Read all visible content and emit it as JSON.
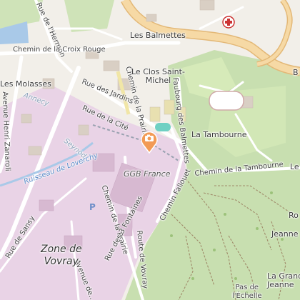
{
  "map": {
    "colors": {
      "urban": "#f2efe9",
      "commercial": "#e9d3e6",
      "forest": "#c8dfb0",
      "park": "#d6eab9",
      "major_road": "#f6d9a5",
      "water": "#a9c9e8",
      "marker": "#f29a55"
    },
    "labels": {
      "rue_vernon": "Rue de l'Hermon",
      "les_balmettes": "Les Balmettes",
      "croix_rouge": "Chemin de la Croix Rouge",
      "les_molasses": "Les Molasses",
      "annecy": "Annecy",
      "henri_zanaroli": "Avenue Henri Zanaroli",
      "rue_des_jardins": "Rue des Jardins",
      "chemin_prairie_top": "Chemin de la Prairie",
      "le_clos": "Le Clos Saint-\nMichel",
      "faubourg": "Faubourg des Balmettes",
      "la_tambourne": "La Tambourne",
      "rue_cite": "Rue de la Cité",
      "seynod": "Seynod",
      "ruisseau": "Ruisseau de Loverchy",
      "ggb": "GGB France",
      "chemin_tambourne": "Chemin de la Tambourne",
      "chemin_fallouet": "Chemin Fallouet",
      "chemin_prairie_bottom": "Chemin de la Prairie",
      "trois_fontaines": "Rue des 3 Fontaines",
      "route_vovray": "Route de Vovray",
      "avenue_de_bottom": "Avenue de...",
      "rue_sansy": "Rue de Sansy",
      "zone_vovray": "Zone de\nVovray",
      "la_grande_jeanne": "La Grande\nJeanne",
      "jeanne": "Jeanne",
      "pas_echelle": "Pas de\nl'Échelle",
      "edge_b": "B",
      "edge_le": "Le",
      "edge_ro": "Ro",
      "parking": "P"
    },
    "icons": {
      "marker": "location-pin-camera-icon",
      "pharmacy": "pharmacy-cross-icon"
    }
  }
}
